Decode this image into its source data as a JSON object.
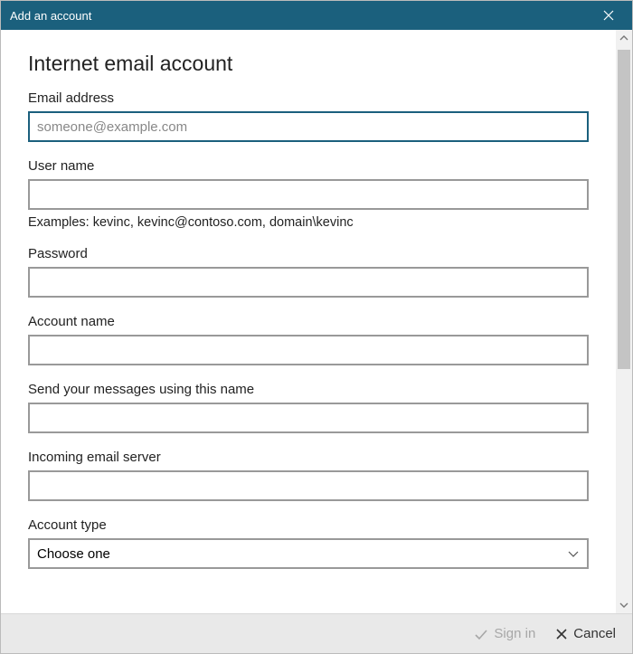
{
  "titlebar": {
    "title": "Add an account"
  },
  "page": {
    "heading": "Internet email account"
  },
  "fields": {
    "email": {
      "label": "Email address",
      "placeholder": "someone@example.com",
      "value": ""
    },
    "username": {
      "label": "User name",
      "helper": "Examples: kevinc, kevinc@contoso.com, domain\\kevinc",
      "value": ""
    },
    "password": {
      "label": "Password",
      "value": ""
    },
    "accountname": {
      "label": "Account name",
      "value": ""
    },
    "sendname": {
      "label": "Send your messages using this name",
      "value": ""
    },
    "incoming": {
      "label": "Incoming email server",
      "value": ""
    },
    "accounttype": {
      "label": "Account type",
      "selected": "Choose one"
    }
  },
  "footer": {
    "signin": "Sign in",
    "cancel": "Cancel"
  }
}
